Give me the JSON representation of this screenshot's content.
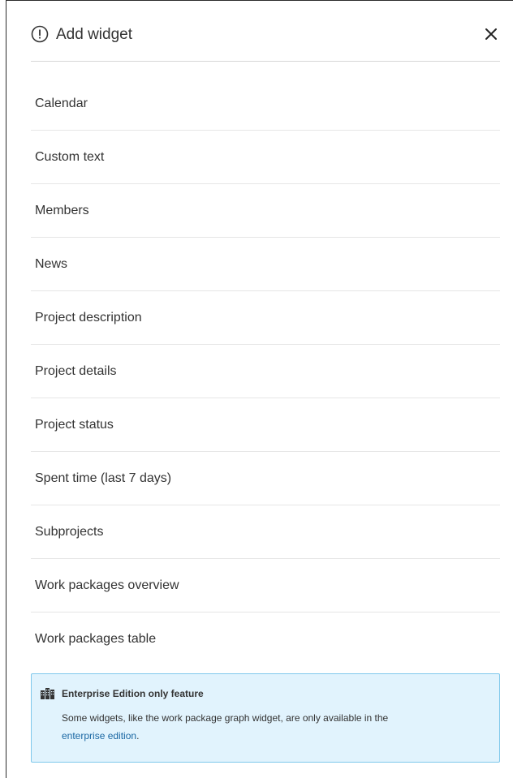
{
  "dialog": {
    "title": "Add widget",
    "title_icon": "info-icon",
    "close_icon": "close-icon"
  },
  "widgets": [
    "Calendar",
    "Custom text",
    "Members",
    "News",
    "Project description",
    "Project details",
    "Project status",
    "Spent time (last 7 days)",
    "Subprojects",
    "Work packages overview",
    "Work packages table"
  ],
  "enterprise_notice": {
    "icon": "enterprise-building-icon",
    "title": "Enterprise Edition only feature",
    "text": "Some widgets, like the work package graph widget, are only available in the",
    "link_text": "enterprise edition",
    "text_end": "."
  },
  "colors": {
    "notice_bg": "#e1f3fd",
    "notice_border": "#7fc8ec",
    "link": "#1a67a3"
  }
}
